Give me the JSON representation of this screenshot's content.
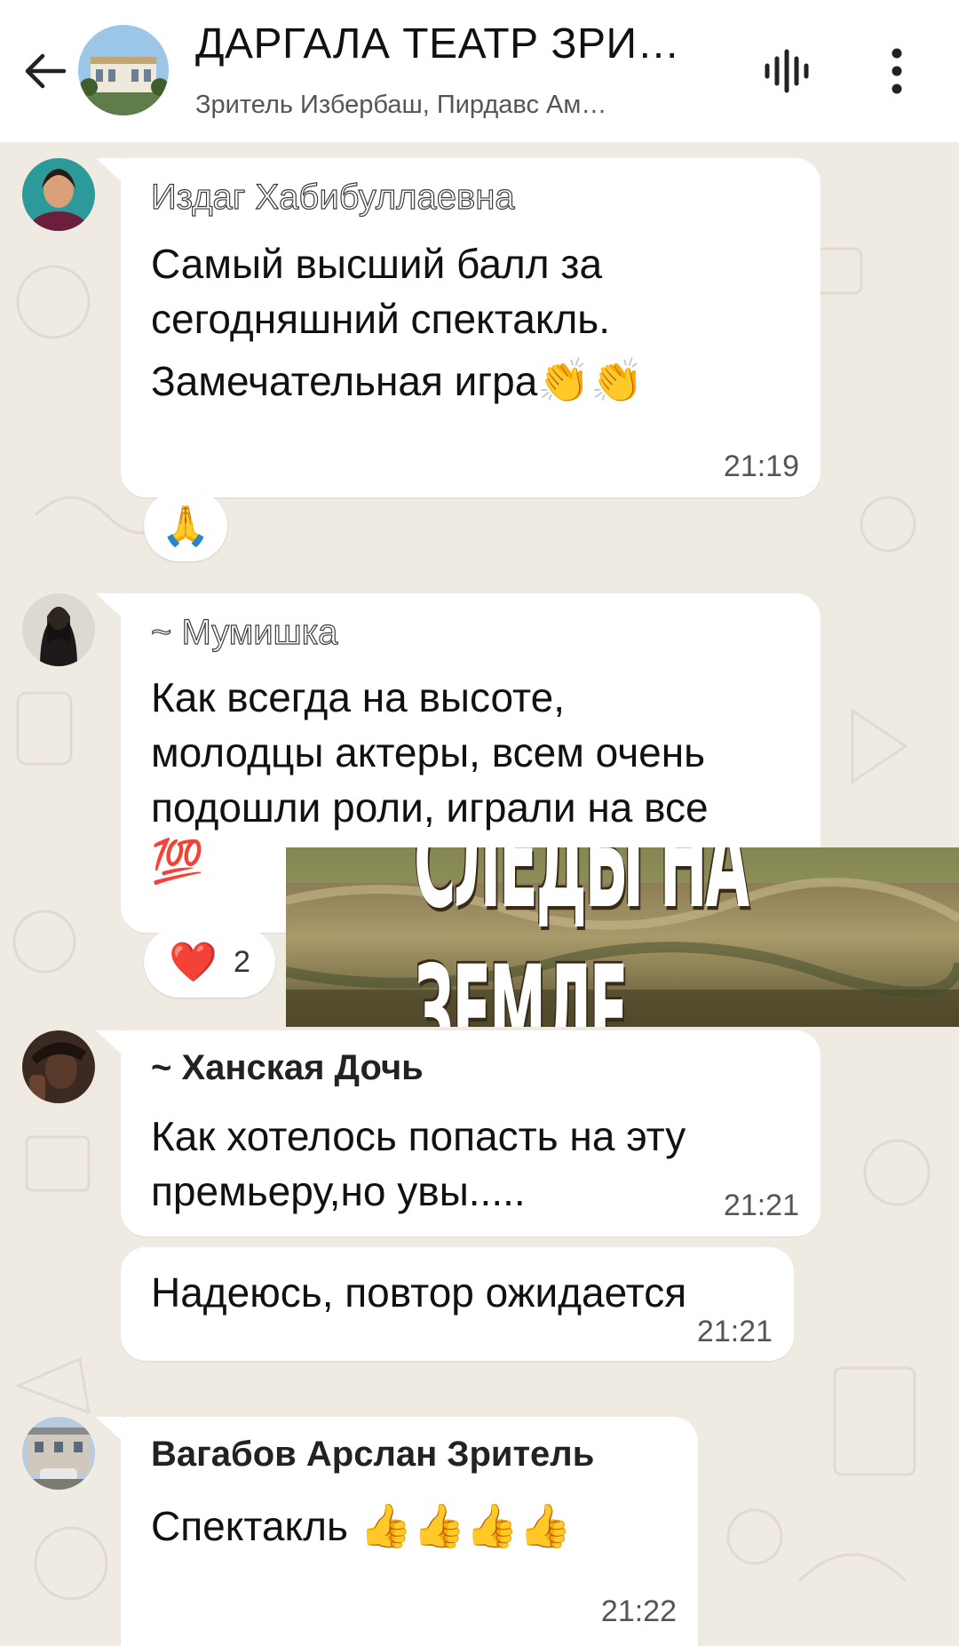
{
  "header": {
    "title": "ДАРГАЛА ТЕАТР ЗРИ…",
    "subtitle": "Зритель Избербаш, Пирдавс Ам…",
    "back_icon": "arrow-left-icon",
    "voice_icon": "voice-call-icon",
    "menu_icon": "more-vertical-icon"
  },
  "messages": [
    {
      "sender": "Издаг Хабибуллаевна",
      "lines": [
        "Самый высший балл за",
        "сегодняшний спектакль.",
        "Замечательная игра"
      ],
      "emoji": "👏👏",
      "time": "21:19",
      "reaction": {
        "emoji": "🙏"
      }
    },
    {
      "sender": "~ Мумишка",
      "lines": [
        "Как всегда на высоте,",
        "молодцы актеры, всем очень",
        "подошли роли, играли на все"
      ],
      "emoji": "💯",
      "reaction": {
        "emoji": "❤️",
        "count": "2"
      }
    },
    {
      "sender": "~ Ханская Дочь",
      "lines": [
        "Как хотелось попасть на эту",
        "премьеру,но увы....."
      ],
      "time": "21:21"
    },
    {
      "lines": [
        "Надеюсь, повтор ожидается"
      ],
      "time": "21:21"
    },
    {
      "sender": "Вагабов Арслан Зритель",
      "lines": [
        "Спектакль"
      ],
      "emoji": "👍👍👍👍",
      "time": "21:22"
    }
  ],
  "overlay_banner": {
    "text": "СЛЕДЫ НА ЗЕМЛЕ"
  }
}
